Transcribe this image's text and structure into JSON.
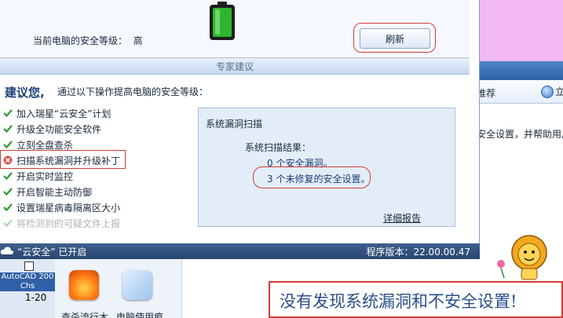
{
  "main_window": {
    "level_label": "当前电脑的安全等级：",
    "level_value": "高",
    "refresh_button": "刷新",
    "section_header": "专家建议",
    "advice_title": "建议您,",
    "advice_subtitle": "通过以下操作提高电脑的安全等级：",
    "actions": [
      {
        "label": "加入瑞星“云安全”计划",
        "status": "done"
      },
      {
        "label": "升级全功能安全软件",
        "status": "done"
      },
      {
        "label": "立刻全盘查杀",
        "status": "done"
      },
      {
        "label": "扫描系统漏洞并升级补丁",
        "status": "error"
      },
      {
        "label": "开启实时监控",
        "status": "done"
      },
      {
        "label": "开启智能主动防御",
        "status": "done"
      },
      {
        "label": "设置瑞星病毒隔离区大小",
        "status": "done"
      },
      {
        "label": "将检测到的可疑文件上报",
        "status": "disabled"
      }
    ],
    "scan_panel": {
      "title": "系统漏洞扫描",
      "result_label": "系统扫描结果：",
      "result_line1": "0 个安全漏洞。",
      "result_line2": "3 个未修复的安全设置。",
      "detail_link": "详细报告"
    },
    "status_bar": {
      "cloud_status": "“云安全” 已开启",
      "version": "程序版本：22.00.00.47"
    }
  },
  "background": {
    "other_window_toolbar_1": "推荐",
    "other_window_toolbar_2": "立",
    "other_window_text": "安全设置，并帮助用户",
    "autocad_label": "AutoCAD 200 Chs",
    "autocad_sub": "1-20",
    "tool1_label": "查杀流行木",
    "tool2_label": "电脑使用痕",
    "notice": "没有发现系统漏洞和不安全设置!"
  },
  "colors": {
    "accent_red": "#d13b3b",
    "status_bar": "#2a466e",
    "check_green": "#2e9a2e",
    "link_blue": "#1a3f7a"
  }
}
